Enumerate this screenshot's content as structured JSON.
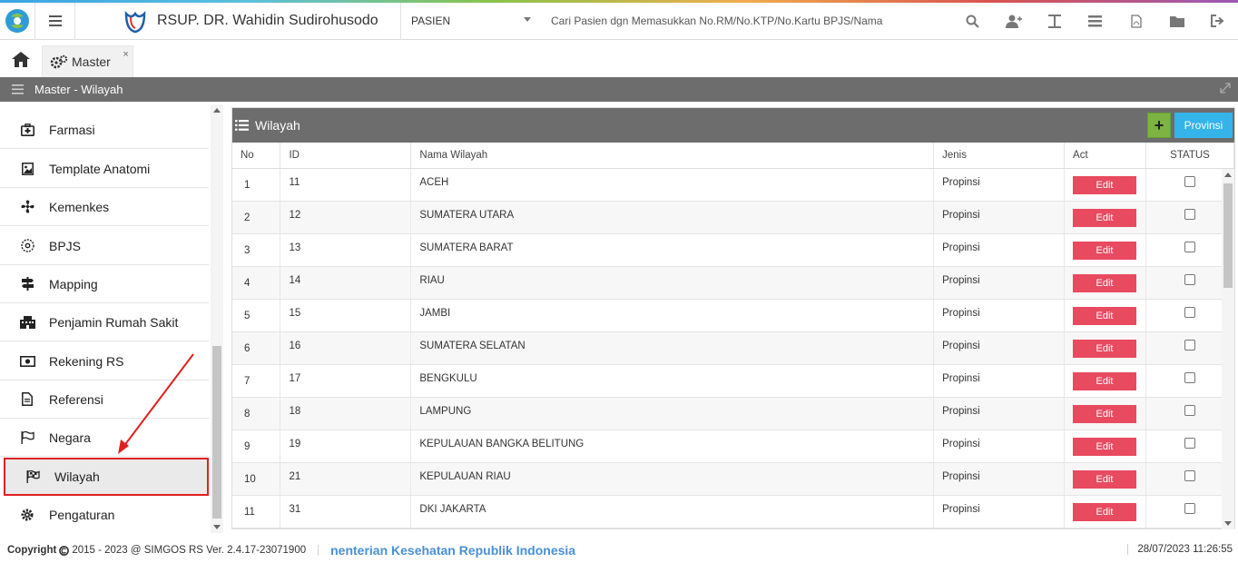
{
  "topbar": {
    "hospital_name": "RSUP. DR. Wahidin Sudirohusodo",
    "select_value": "PASIEN",
    "search_placeholder": "Cari Pasien dgn Memasukkan No.RM/No.KTP/No.Kartu BPJS/Nama",
    "icons": [
      "search-icon",
      "add-user-icon",
      "text-icon",
      "list-icon",
      "pdf-icon",
      "folder-icon",
      "sign-out-icon"
    ]
  },
  "tabs": [
    {
      "label": "Master",
      "close": "×"
    }
  ],
  "section": {
    "title": "Master - Wilayah"
  },
  "sidebar": {
    "items": [
      {
        "label": "Farmasi",
        "icon": "medkit-icon"
      },
      {
        "label": "Template Anatomi",
        "icon": "image-icon"
      },
      {
        "label": "Kemenkes",
        "icon": "fan-icon"
      },
      {
        "label": "BPJS",
        "icon": "gear-circle-icon"
      },
      {
        "label": "Mapping",
        "icon": "signpost-icon"
      },
      {
        "label": "Penjamin Rumah Sakit",
        "icon": "building-icon"
      },
      {
        "label": "Rekening RS",
        "icon": "money-icon"
      },
      {
        "label": "Referensi",
        "icon": "file-icon"
      },
      {
        "label": "Negara",
        "icon": "flag-outline-icon"
      },
      {
        "label": "Wilayah",
        "icon": "flag-checkered-icon"
      },
      {
        "label": "Pengaturan",
        "icon": "cog-icon"
      }
    ],
    "active": "Wilayah"
  },
  "panel": {
    "title": "Wilayah",
    "add_label": "+",
    "provinsi_label": "Provinsi",
    "columns": [
      "No",
      "ID",
      "Nama Wilayah",
      "Jenis",
      "Act",
      "STATUS"
    ],
    "edit_label": "Edit",
    "rows": [
      {
        "no": "1",
        "id": "11",
        "nama": "ACEH",
        "jenis": "Propinsi"
      },
      {
        "no": "2",
        "id": "12",
        "nama": "SUMATERA UTARA",
        "jenis": "Propinsi"
      },
      {
        "no": "3",
        "id": "13",
        "nama": "SUMATERA BARAT",
        "jenis": "Propinsi"
      },
      {
        "no": "4",
        "id": "14",
        "nama": "RIAU",
        "jenis": "Propinsi"
      },
      {
        "no": "5",
        "id": "15",
        "nama": "JAMBI",
        "jenis": "Propinsi"
      },
      {
        "no": "6",
        "id": "16",
        "nama": "SUMATERA SELATAN",
        "jenis": "Propinsi"
      },
      {
        "no": "7",
        "id": "17",
        "nama": "BENGKULU",
        "jenis": "Propinsi"
      },
      {
        "no": "8",
        "id": "18",
        "nama": "LAMPUNG",
        "jenis": "Propinsi"
      },
      {
        "no": "9",
        "id": "19",
        "nama": "KEPULAUAN BANGKA BELITUNG",
        "jenis": "Propinsi"
      },
      {
        "no": "10",
        "id": "21",
        "nama": "KEPULAUAN RIAU",
        "jenis": "Propinsi"
      },
      {
        "no": "11",
        "id": "31",
        "nama": "DKI JAKARTA",
        "jenis": "Propinsi"
      }
    ]
  },
  "footer": {
    "copyright_label": "Copyright",
    "copyright_text": "2015 - 2023 @ SIMGOS RS Ver. 2.4.17-23071900",
    "marquee": "nenterian Kesehatan Republik Indonesia",
    "datetime": "28/07/2023 11:26:55"
  },
  "colors": {
    "header_gray": "#6d6d6d",
    "edit_red": "#e84a5f",
    "add_green": "#7cb342",
    "provinsi_blue": "#34b4e8",
    "highlight_red": "#e02020"
  }
}
